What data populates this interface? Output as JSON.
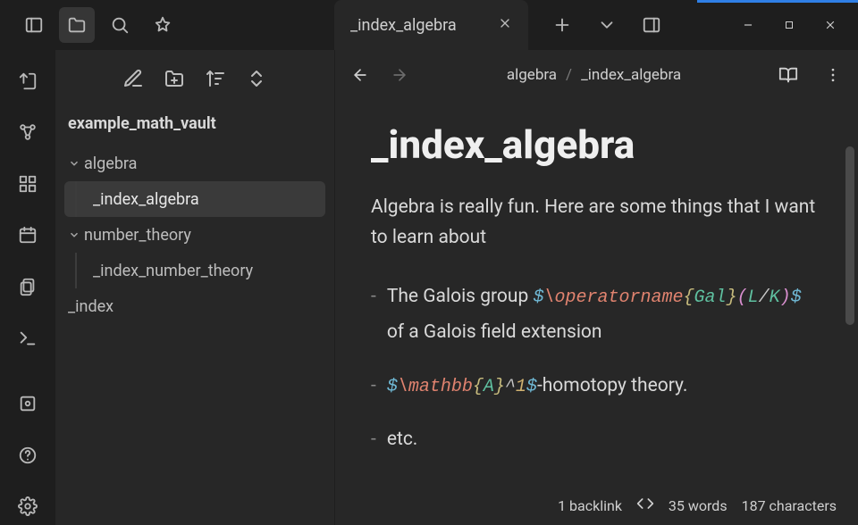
{
  "tab": {
    "title": "_index_algebra"
  },
  "sidebar": {
    "vault": "example_math_vault",
    "folders": [
      {
        "name": "algebra",
        "files": [
          "_index_algebra"
        ],
        "selected": 0
      },
      {
        "name": "number_theory",
        "files": [
          "_index_number_theory"
        ]
      }
    ],
    "root_files": [
      "_index"
    ]
  },
  "breadcrumb": {
    "parent": "algebra",
    "current": "_index_algebra"
  },
  "doc": {
    "title": "_index_algebra",
    "intro": "Algebra is really fun. Here are some things that I want to learn about",
    "bullets": [
      {
        "pre": "The Galois group ",
        "latex_parts": [
          {
            "t": "$",
            "c": "c-dollar"
          },
          {
            "t": "\\operatorname",
            "c": "c-cmd"
          },
          {
            "t": "{",
            "c": "c-brace"
          },
          {
            "t": "Gal",
            "c": "c-sym"
          },
          {
            "t": "}",
            "c": "c-brace"
          },
          {
            "t": "(",
            "c": "c-brack"
          },
          {
            "t": "L",
            "c": "c-sym"
          },
          {
            "t": "/",
            "c": "c-car"
          },
          {
            "t": "K",
            "c": "c-sym"
          },
          {
            "t": ")",
            "c": "c-brack"
          },
          {
            "t": "$",
            "c": "c-dollar"
          }
        ],
        "post": " of a Galois field extension"
      },
      {
        "pre": "",
        "latex_parts": [
          {
            "t": "$",
            "c": "c-dollar"
          },
          {
            "t": "\\mathbb",
            "c": "c-cmd"
          },
          {
            "t": "{",
            "c": "c-brace"
          },
          {
            "t": "A",
            "c": "c-sym"
          },
          {
            "t": "}",
            "c": "c-brace"
          },
          {
            "t": "^",
            "c": "c-car"
          },
          {
            "t": "1",
            "c": "c-num"
          },
          {
            "t": "$",
            "c": "c-dollar"
          }
        ],
        "post": "-homotopy theory."
      },
      {
        "pre": "etc.",
        "latex_parts": [],
        "post": ""
      }
    ]
  },
  "status": {
    "backlinks": "1 backlink",
    "words": "35 words",
    "chars": "187 characters"
  }
}
